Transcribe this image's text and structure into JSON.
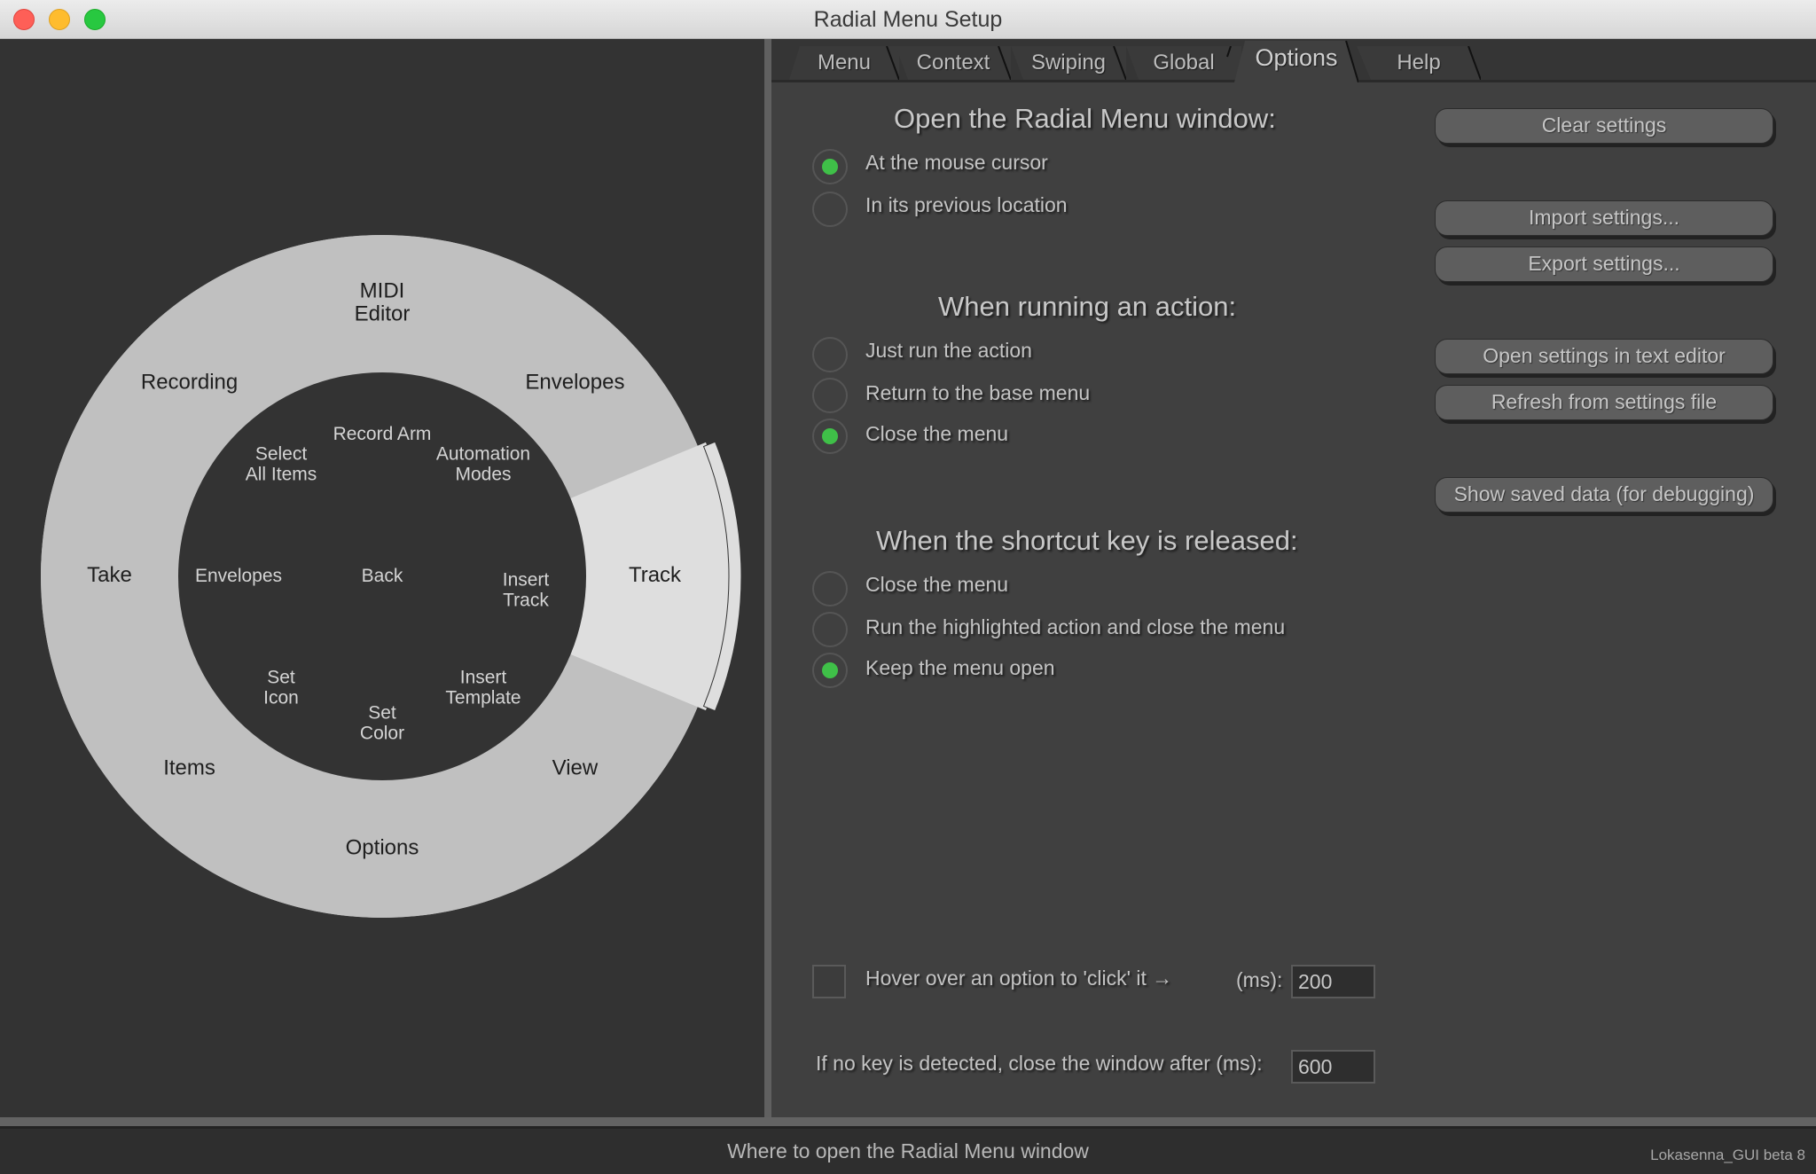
{
  "window": {
    "title": "Radial Menu Setup"
  },
  "tabs": [
    {
      "label": "Menu",
      "active": false
    },
    {
      "label": "Context",
      "active": false
    },
    {
      "label": "Swiping",
      "active": false
    },
    {
      "label": "Global",
      "active": false
    },
    {
      "label": "Options",
      "active": true
    },
    {
      "label": "Help",
      "active": false
    }
  ],
  "radial_menu": {
    "outer_ring": [
      {
        "label": "MIDI\nEditor",
        "angle_deg": 90
      },
      {
        "label": "Envelopes",
        "angle_deg": 45
      },
      {
        "label": "Track",
        "angle_deg": 0,
        "highlighted": true
      },
      {
        "label": "View",
        "angle_deg": -45
      },
      {
        "label": "Options",
        "angle_deg": -90
      },
      {
        "label": "Items",
        "angle_deg": -135
      },
      {
        "label": "Take",
        "angle_deg": 180
      },
      {
        "label": "Recording",
        "angle_deg": 135
      }
    ],
    "inner_items": [
      {
        "label": "Record Arm",
        "pos": "n"
      },
      {
        "label": "Automation\nModes",
        "pos": "ne"
      },
      {
        "label": "Insert\nTrack",
        "pos": "e"
      },
      {
        "label": "Insert\nTemplate",
        "pos": "se"
      },
      {
        "label": "Set\nColor",
        "pos": "s"
      },
      {
        "label": "Set\nIcon",
        "pos": "sw"
      },
      {
        "label": "Envelopes",
        "pos": "w"
      },
      {
        "label": "Select\nAll Items",
        "pos": "nw"
      },
      {
        "label": "Back",
        "pos": "center"
      }
    ],
    "colors": {
      "ring": "#c0c0c0",
      "highlight": "#dedede",
      "center": "#333333",
      "ring_text": "#1e1e1e",
      "center_text": "#d4d4d4"
    }
  },
  "options": {
    "open_window": {
      "heading": "Open the Radial Menu window:",
      "choices": [
        {
          "label": "At the mouse cursor",
          "selected": true
        },
        {
          "label": "In its previous location",
          "selected": false
        }
      ]
    },
    "running_action": {
      "heading": "When running an action:",
      "choices": [
        {
          "label": "Just run the action",
          "selected": false
        },
        {
          "label": "Return to the base menu",
          "selected": false
        },
        {
          "label": "Close the menu",
          "selected": true
        }
      ]
    },
    "shortcut_released": {
      "heading": "When the shortcut key is released:",
      "choices": [
        {
          "label": "Close the menu",
          "selected": false
        },
        {
          "label": "Run the highlighted action and close the menu",
          "selected": false
        },
        {
          "label": "Keep the menu open",
          "selected": true
        }
      ]
    },
    "hover": {
      "label": "Hover over an option to 'click' it →",
      "checked": false,
      "ms_label": "(ms):",
      "ms_value": "200"
    },
    "no_key": {
      "label": "If no key is detected, close the window after (ms):",
      "value": "600"
    }
  },
  "buttons": {
    "clear": "Clear settings",
    "import": "Import settings...",
    "export": "Export settings...",
    "open_editor": "Open settings in text editor",
    "refresh": "Refresh from settings file",
    "show_saved": "Show saved data (for debugging)"
  },
  "status": {
    "text": "Where to open the Radial Menu window",
    "version": "Lokasenna_GUI beta 8"
  },
  "colors": {
    "radio_selected": "#3fc048",
    "panel_bg": "#404040",
    "left_bg": "#333333"
  }
}
